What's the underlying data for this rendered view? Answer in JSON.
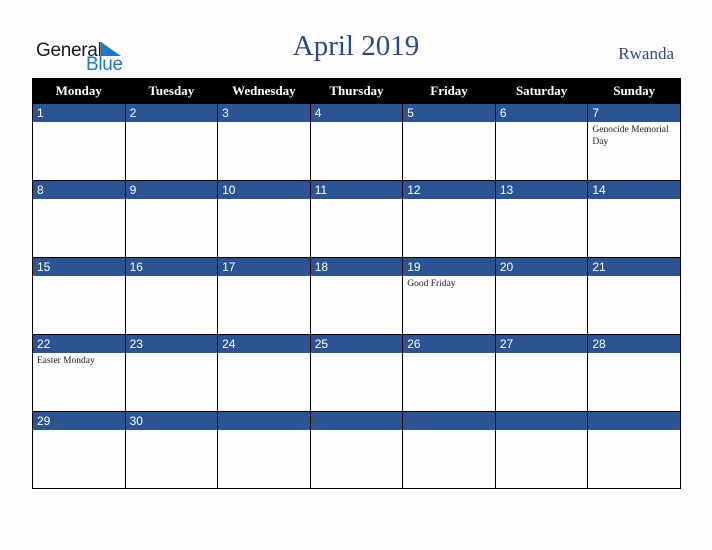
{
  "logo": {
    "line1": "General",
    "line2": "Blue"
  },
  "header": {
    "title": "April 2019",
    "country": "Rwanda"
  },
  "colors": {
    "day_bar": "#2c5494",
    "header_bg": "#000000",
    "title": "#2c4a82",
    "logo_blue": "#1f78c1"
  },
  "weekdays": [
    "Monday",
    "Tuesday",
    "Wednesday",
    "Thursday",
    "Friday",
    "Saturday",
    "Sunday"
  ],
  "weeks": [
    [
      {
        "day": "1",
        "event": ""
      },
      {
        "day": "2",
        "event": ""
      },
      {
        "day": "3",
        "event": ""
      },
      {
        "day": "4",
        "event": ""
      },
      {
        "day": "5",
        "event": ""
      },
      {
        "day": "6",
        "event": ""
      },
      {
        "day": "7",
        "event": "Genocide Memorial Day"
      }
    ],
    [
      {
        "day": "8",
        "event": ""
      },
      {
        "day": "9",
        "event": ""
      },
      {
        "day": "10",
        "event": ""
      },
      {
        "day": "11",
        "event": ""
      },
      {
        "day": "12",
        "event": ""
      },
      {
        "day": "13",
        "event": ""
      },
      {
        "day": "14",
        "event": ""
      }
    ],
    [
      {
        "day": "15",
        "event": ""
      },
      {
        "day": "16",
        "event": ""
      },
      {
        "day": "17",
        "event": ""
      },
      {
        "day": "18",
        "event": ""
      },
      {
        "day": "19",
        "event": "Good Friday"
      },
      {
        "day": "20",
        "event": ""
      },
      {
        "day": "21",
        "event": ""
      }
    ],
    [
      {
        "day": "22",
        "event": "Easter Monday"
      },
      {
        "day": "23",
        "event": ""
      },
      {
        "day": "24",
        "event": ""
      },
      {
        "day": "25",
        "event": ""
      },
      {
        "day": "26",
        "event": ""
      },
      {
        "day": "27",
        "event": ""
      },
      {
        "day": "28",
        "event": ""
      }
    ],
    [
      {
        "day": "29",
        "event": ""
      },
      {
        "day": "30",
        "event": ""
      },
      {
        "day": "",
        "event": ""
      },
      {
        "day": "",
        "event": ""
      },
      {
        "day": "",
        "event": ""
      },
      {
        "day": "",
        "event": ""
      },
      {
        "day": "",
        "event": ""
      }
    ]
  ]
}
